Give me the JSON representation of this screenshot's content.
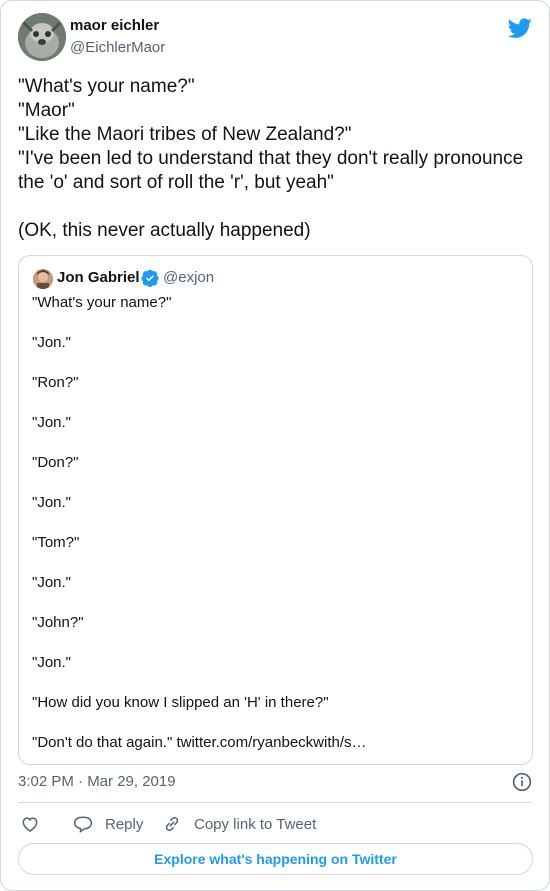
{
  "author": {
    "name": "maor eichler",
    "handle": "@EichlerMaor"
  },
  "tweet": {
    "text": "\"What's your name?\"\n\"Maor\"\n\"Like the Maori tribes of New Zealand?\"\n\"I've been led to understand that they don't really pronounce the 'o' and sort of roll the 'r', but yeah\"\n\n(OK, this never actually happened)",
    "timestamp": "3:02 PM · Mar 29, 2019"
  },
  "quoted": {
    "name": "Jon Gabriel",
    "handle": "@exjon",
    "text": "\"What's your name?\"\n\n\"Jon.\"\n\n\"Ron?\"\n\n\"Jon.\"\n\n\"Don?\"\n\n\"Jon.\"\n\n\"Tom?\"\n\n\"Jon.\"\n\n\"John?\"\n\n\"Jon.\"\n\n\"How did you know I slipped an 'H' in there?\"\n\n\"Don't do that again.\" twitter.com/ryanbeckwith/s…"
  },
  "actions": {
    "reply_label": "Reply",
    "copy_label": "Copy link to Tweet",
    "explore_label": "Explore what's happening on Twitter"
  },
  "icons": {
    "twitter": "twitter-bird-icon",
    "verified": "verified-badge-icon",
    "info": "info-icon",
    "like": "heart-icon",
    "reply": "speech-bubble-icon",
    "copy": "link-icon"
  },
  "colors": {
    "brand": "#1d9bf0",
    "text": "#0f1419",
    "secondary": "#536471",
    "border": "#cfd9de"
  }
}
